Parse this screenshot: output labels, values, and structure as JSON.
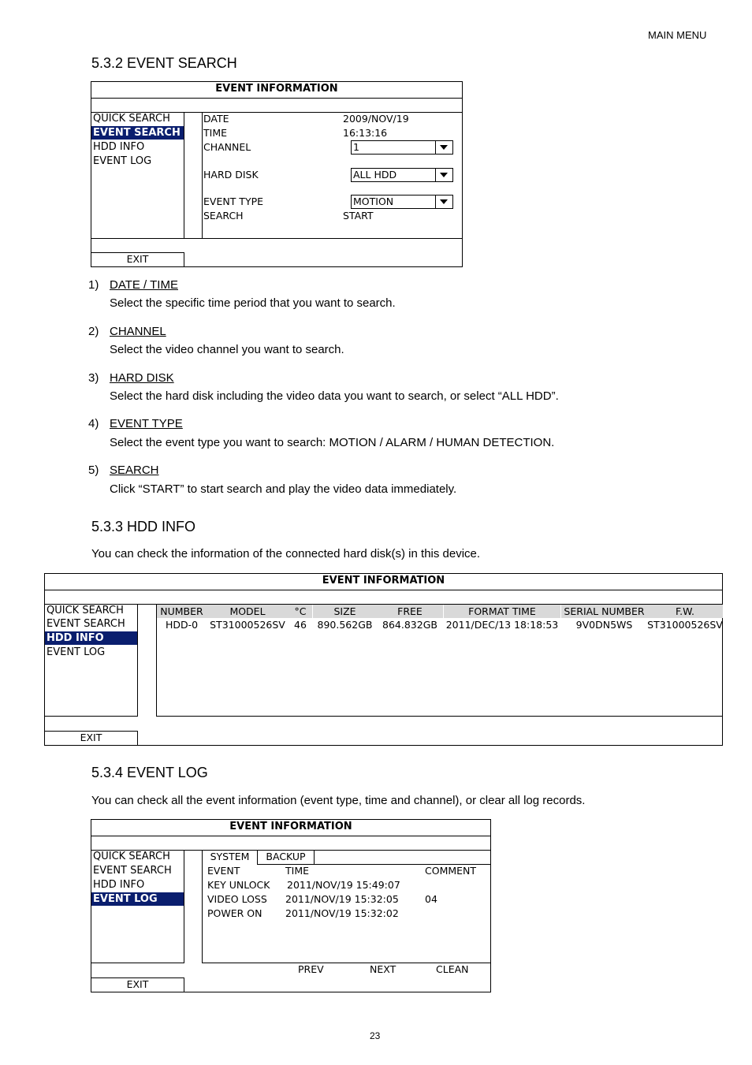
{
  "page_header": "MAIN MENU",
  "page_number": "23",
  "sections": {
    "event_search": {
      "title": "5.3.2 EVENT SEARCH",
      "panel": {
        "title": "EVENT INFORMATION",
        "menu": [
          "QUICK SEARCH",
          "EVENT SEARCH",
          "HDD INFO",
          "EVENT LOG"
        ],
        "selected_menu": "EVENT SEARCH",
        "exit_label": "EXIT",
        "fields": {
          "date_label": "DATE",
          "date_value": "2009/NOV/19",
          "time_label": "TIME",
          "time_value": "16:13:16",
          "channel_label": "CHANNEL",
          "channel_value": "1",
          "hard_disk_label": "HARD DISK",
          "hard_disk_value": "ALL HDD",
          "event_type_label": "EVENT TYPE",
          "event_type_value": "MOTION",
          "search_label": "SEARCH",
          "search_value": "START"
        }
      },
      "items": [
        {
          "num": "1)",
          "title": "DATE / TIME",
          "desc": "Select the specific time period that you want to search."
        },
        {
          "num": "2)",
          "title": "CHANNEL",
          "desc": "Select the video channel you want to search."
        },
        {
          "num": "3)",
          "title": "HARD DISK",
          "desc": "Select the hard disk including the video data you want to search, or select “ALL HDD”."
        },
        {
          "num": "4)",
          "title": "EVENT TYPE",
          "desc": "Select the event type you want to search: MOTION / ALARM / HUMAN DETECTION."
        },
        {
          "num": "5)",
          "title": "SEARCH",
          "desc": "Click “START” to start search and play the video data immediately."
        }
      ]
    },
    "hdd_info": {
      "title": "5.3.3 HDD INFO",
      "desc": "You can check the information of the connected hard disk(s) in this device.",
      "panel": {
        "title": "EVENT INFORMATION",
        "menu": [
          "QUICK SEARCH",
          "EVENT SEARCH",
          "HDD INFO",
          "EVENT LOG"
        ],
        "selected_menu": "HDD INFO",
        "exit_label": "EXIT",
        "columns": [
          "NUMBER",
          "MODEL",
          "°C",
          "SIZE",
          "FREE",
          "FORMAT TIME",
          "SERIAL NUMBER",
          "F.W."
        ],
        "rows": [
          [
            "HDD-0",
            "ST31000526SV",
            "46",
            "890.562GB",
            "864.832GB",
            "2011/DEC/13 18:18:53",
            "9V0DN5WS",
            "ST31000526SV"
          ]
        ]
      }
    },
    "event_log": {
      "title": "5.3.4 EVENT LOG",
      "desc": "You can check all the event information (event type, time and channel), or clear all log records.",
      "panel": {
        "title": "EVENT INFORMATION",
        "menu": [
          "QUICK SEARCH",
          "EVENT SEARCH",
          "HDD INFO",
          "EVENT LOG"
        ],
        "selected_menu": "EVENT LOG",
        "exit_label": "EXIT",
        "tabs": [
          "SYSTEM",
          "BACKUP"
        ],
        "active_tab": "SYSTEM",
        "columns": [
          "EVENT",
          "TIME",
          "COMMENT"
        ],
        "rows": [
          [
            "KEY UNLOCK",
            "2011/NOV/19 15:49:07",
            ""
          ],
          [
            "VIDEO LOSS",
            "2011/NOV/19 15:32:05",
            "04"
          ],
          [
            "POWER ON",
            "2011/NOV/19 15:32:02",
            ""
          ]
        ],
        "buttons": [
          "PREV",
          "NEXT",
          "CLEAN"
        ]
      }
    }
  },
  "colors": {
    "selected_bg": "#0a1e6e",
    "table_header_bg": "#d9d9d9"
  }
}
